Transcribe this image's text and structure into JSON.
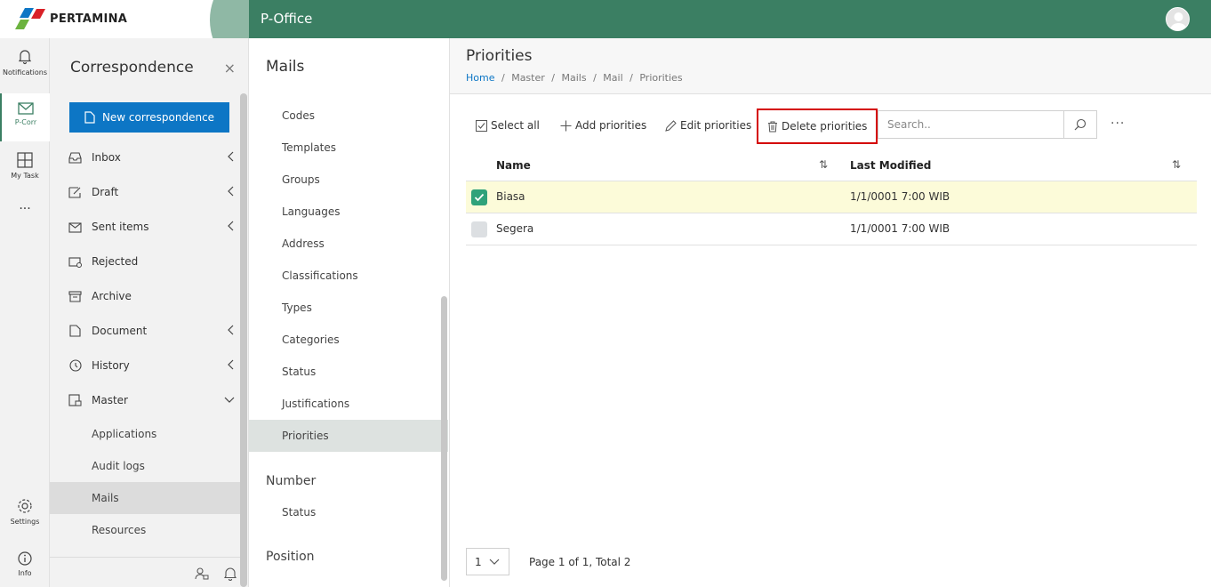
{
  "brand": {
    "name": "PERTAMINA"
  },
  "header": {
    "app_title": "P-Office"
  },
  "rail": {
    "notifications": "Notifications",
    "pcorr": "P-Corr",
    "mytask": "My Task",
    "more": "···",
    "settings": "Settings",
    "info": "Info"
  },
  "correspondence": {
    "title": "Correspondence",
    "close": "×",
    "new_button": "New correspondence",
    "items": [
      {
        "label": "Inbox"
      },
      {
        "label": "Draft"
      },
      {
        "label": "Sent items"
      },
      {
        "label": "Rejected"
      },
      {
        "label": "Archive"
      },
      {
        "label": "Document"
      },
      {
        "label": "History"
      },
      {
        "label": "Master"
      }
    ],
    "master_sub": [
      {
        "label": "Applications"
      },
      {
        "label": "Audit logs"
      },
      {
        "label": "Mails"
      },
      {
        "label": "Resources"
      }
    ]
  },
  "mails_panel": {
    "title": "Mails",
    "items": [
      "Codes",
      "Templates",
      "Groups",
      "Languages",
      "Address",
      "Classifications",
      "Types",
      "Categories",
      "Status",
      "Justifications",
      "Priorities"
    ],
    "number_title": "Number",
    "number_items": [
      "Status"
    ],
    "position_title": "Position"
  },
  "main": {
    "title": "Priorities",
    "breadcrumb": [
      "Home",
      "/",
      "Master",
      "/",
      "Mails",
      "/",
      "Mail",
      "/",
      "Priorities"
    ],
    "toolbar": {
      "select_all": "Select all",
      "add": "Add priorities",
      "edit": "Edit priorities",
      "delete": "Delete priorities",
      "search_placeholder": "Search..",
      "more": "···"
    },
    "table": {
      "columns": [
        "Name",
        "Last Modified"
      ],
      "rows": [
        {
          "name": "Biasa",
          "modified": "1/1/0001 7:00 WIB",
          "checked": true
        },
        {
          "name": "Segera",
          "modified": "1/1/0001 7:00 WIB",
          "checked": false
        }
      ]
    },
    "pager": {
      "page_size": "1",
      "text": "Page 1 of 1, Total 2"
    }
  },
  "colors": {
    "header_green": "#3b7f63",
    "primary_blue": "#0d76c5",
    "highlight_red": "#d40000",
    "selected_row": "#fcfbd9",
    "check_green": "#2fa27a"
  }
}
